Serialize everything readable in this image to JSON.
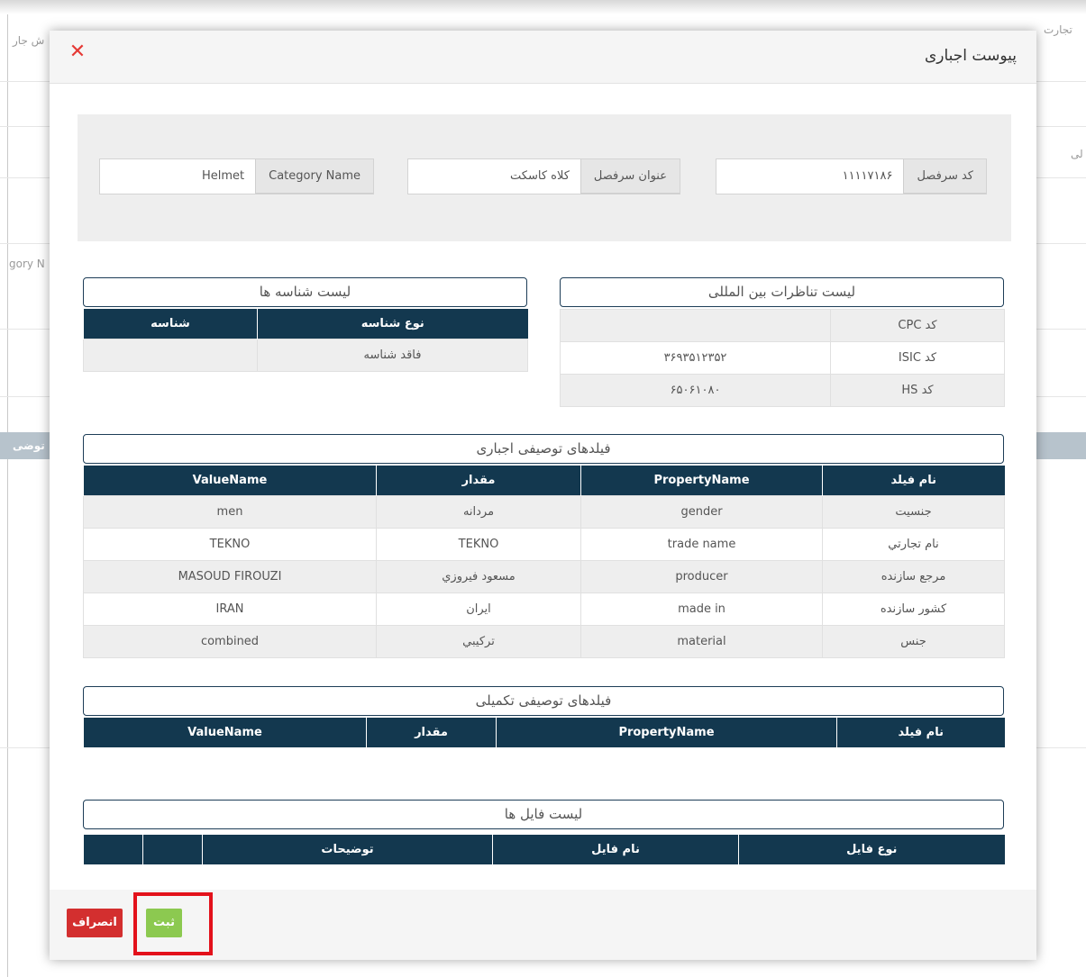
{
  "background": {
    "fragments": [
      "تجارت",
      "ش جار",
      "لی",
      "gory N",
      "توضی"
    ]
  },
  "modal": {
    "title": "پیوست اجباری",
    "close_icon": "close-icon"
  },
  "category_info": {
    "code_label": "کد سرفصل",
    "code_value": "۱۱۱۱۷۱۸۶",
    "title_label": "عنوان سرفصل",
    "title_value": "کلاه کاسکت",
    "name_label": "Category Name",
    "name_value": "Helmet"
  },
  "intl_mapping": {
    "title": "لیست تناظرات بین المللی",
    "rows": [
      {
        "label": "کد CPC",
        "value": ""
      },
      {
        "label": "کد ISIC",
        "value": "۳۶۹۳۵۱۲۳۵۲"
      },
      {
        "label": "کد HS",
        "value": "۶۵۰۶۱۰۸۰"
      }
    ]
  },
  "identifiers": {
    "title": "لیست شناسه ها",
    "headers": [
      "نوع شناسه",
      "شناسه"
    ],
    "rows": [
      [
        "فاقد شناسه",
        ""
      ]
    ]
  },
  "mandatory_fields": {
    "title": "فیلدهای توصیفی اجباری",
    "headers": [
      "نام فیلد",
      "PropertyName",
      "مقدار",
      "ValueName"
    ],
    "rows": [
      [
        "جنسيت",
        "gender",
        "مردانه",
        "men"
      ],
      [
        "نام تجارتي",
        "trade name",
        "TEKNO",
        "TEKNO"
      ],
      [
        "مرجع سازنده",
        "producer",
        "مسعود فيروزي",
        "MASOUD FIROUZI"
      ],
      [
        "كشور سازنده",
        "made in",
        "ايران",
        "IRAN"
      ],
      [
        "جنس",
        "material",
        "تركيبي",
        "combined"
      ]
    ]
  },
  "supplementary_fields": {
    "title": "فیلدهای توصیفی تکمیلی",
    "headers": [
      "نام فیلد",
      "PropertyName",
      "مقدار",
      "ValueName"
    ]
  },
  "files": {
    "title": "لیست فایل ها",
    "headers": [
      "نوع فایل",
      "نام فایل",
      "توضیحات",
      "",
      ""
    ]
  },
  "footer": {
    "submit_label": "ثبت",
    "cancel_label": "انصراف"
  },
  "colors": {
    "header_bg": "#13384f",
    "submit": "#8cc950",
    "cancel": "#d32f2f",
    "highlight": "#e3111b",
    "close": "#e53935"
  }
}
